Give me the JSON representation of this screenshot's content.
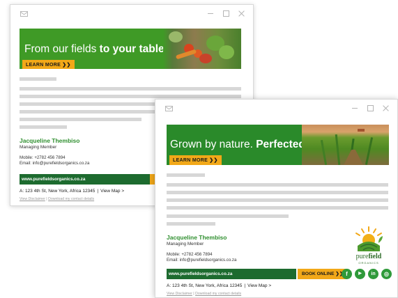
{
  "window1": {
    "banner": {
      "text_plain": "From our fields ",
      "text_bold": "to your table",
      "button": "LEARN MORE ❯❯"
    },
    "signature": {
      "name": "Jacqueline Thembiso",
      "role": "Managing Member",
      "mobile": "Mobile: +2782 456 7894",
      "email": "Email: info@purefieldsorganics.co.za",
      "website": "www.purefieldsorganics.co.za",
      "address": "A: 123 4th St, New York, Africa 12345",
      "separator": "|",
      "map_link": "View Map >",
      "disclaimer_link": "View Disclaimer",
      "foot_separator": "|",
      "download_link": "Download my contact details"
    }
  },
  "window2": {
    "banner": {
      "text_plain": "Grown by nature. ",
      "text_bold": "Perfected by care.",
      "button": "LEARN MORE ❯❯"
    },
    "signature": {
      "name": "Jacqueline Thembiso",
      "role": "Managing Member",
      "mobile": "Mobile: +2782 456 7894",
      "email": "Email: info@purefieldsorganics.co.za",
      "website": "www.purefieldsorganics.co.za",
      "book_button": "BOOK ONLINE ❯❯",
      "address": "A: 123 4th St, New York, Africa 12345",
      "separator": "|",
      "map_link": "View Map >",
      "disclaimer_link": "View Disclaimer",
      "foot_separator": "|",
      "download_link": "Download my contact details"
    },
    "social": [
      {
        "icon": "facebook-icon",
        "glyph": "f"
      },
      {
        "icon": "youtube-icon",
        "glyph": "▶"
      },
      {
        "icon": "linkedin-icon",
        "glyph": "in"
      },
      {
        "icon": "instagram-icon",
        "glyph": "◎"
      }
    ],
    "logo": {
      "word_pure": "pure",
      "word_field": "field",
      "sub": "ORGANICS"
    }
  },
  "colors": {
    "brand_green": "#2f8f2f",
    "dark_green": "#1d6b2f",
    "accent_orange": "#f2a818",
    "placeholder_gray": "#d7d7d7"
  }
}
